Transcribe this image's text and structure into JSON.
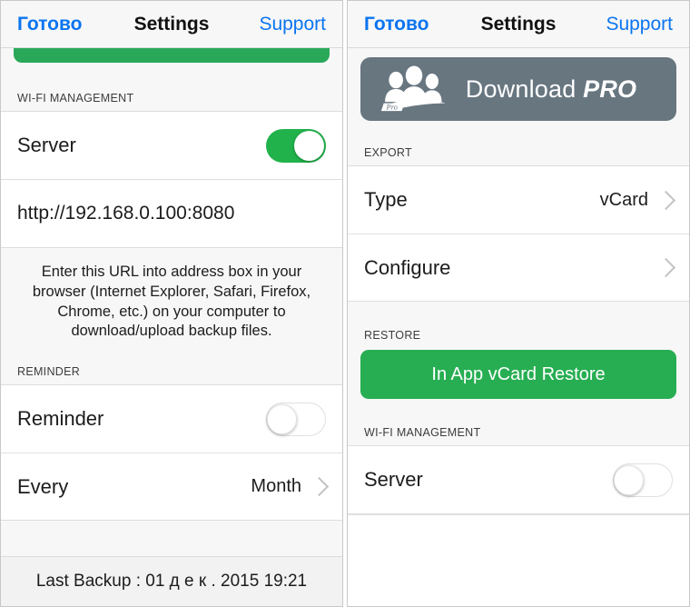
{
  "navbar": {
    "back_label": "Готово",
    "title": "Settings",
    "support_label": "Support"
  },
  "left_screen": {
    "sections": {
      "wifi_management_header": "WI-FI MANAGEMENT",
      "reminder_header": "REMINDER"
    },
    "server_row": {
      "label": "Server",
      "toggle_state": "on"
    },
    "url_row": {
      "value": "http://192.168.0.100:8080"
    },
    "note": "Enter this URL into address box in your browser (Internet Explorer, Safari, Firefox, Chrome, etc.) on your computer to download/upload backup files.",
    "reminder_row": {
      "label": "Reminder",
      "toggle_state": "off"
    },
    "every_row": {
      "label": "Every",
      "value": "Month"
    },
    "last_backup": "Last Backup : 01 д е к . 2015 19:21"
  },
  "right_screen": {
    "pro_banner": {
      "text_main": "Download ",
      "text_pro": "PRO",
      "icon_badge": "Pro"
    },
    "sections": {
      "export_header": "EXPORT",
      "restore_header": "RESTORE",
      "wifi_management_header": "WI-FI MANAGEMENT"
    },
    "type_row": {
      "label": "Type",
      "value": "vCard"
    },
    "configure_row": {
      "label": "Configure"
    },
    "restore_button": {
      "label": "In App vCard Restore"
    },
    "server_row": {
      "label": "Server",
      "toggle_state": "off"
    }
  },
  "colors": {
    "accent_blue": "#0a74f0",
    "toggle_green": "#21b24b",
    "button_green": "#27ae52",
    "banner_gray": "#687680",
    "background": "#f7f7f7"
  }
}
